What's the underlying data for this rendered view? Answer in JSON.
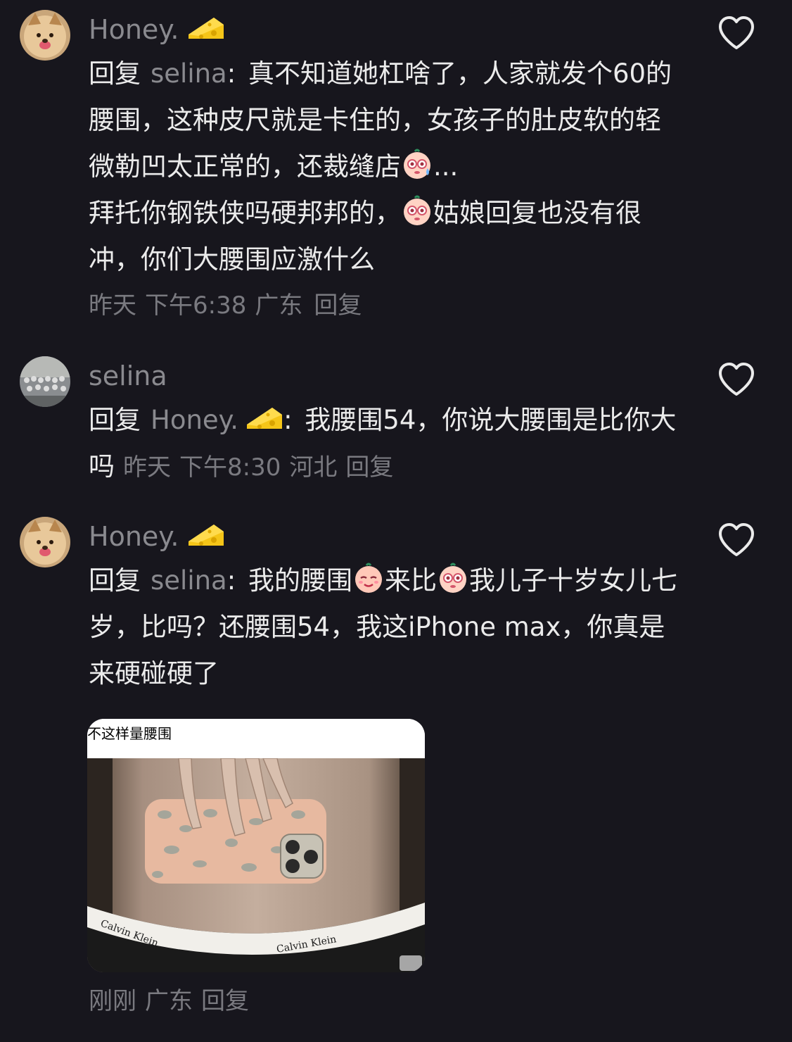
{
  "comments": [
    {
      "author": "Honey.",
      "reply_word": "回复",
      "reply_target": "selina",
      "colon": ":",
      "text": "真不知道她杠啥了，人家就发个60的腰围，这种皮尺就是卡住的，女孩子的肚皮软的轻微勒凹太正常的，还裁缝店",
      "text_tail": "...",
      "text_line2_pre": "拜托你钢铁侠吗硬邦邦的，",
      "text_line2_post": "姑娘回复也没有很冲，你们大腰围应激什么",
      "date": "昨天",
      "time": "下午6:38",
      "location": "广东",
      "reply_label": "回复"
    },
    {
      "author": "selina",
      "reply_word": "回复",
      "reply_target": "Honey.",
      "colon": ":",
      "text": "我腰围54，你说大腰围是比你大吗",
      "date": "昨天",
      "time": "下午8:30",
      "location": "河北",
      "reply_label": "回复"
    },
    {
      "author": "Honey.",
      "reply_word": "回复",
      "reply_target": "selina",
      "colon": ":",
      "text_part1": "我的腰围",
      "text_part2": "来比",
      "text_part3": "我儿子十岁女儿七岁，比吗？还腰围54，我这iPhone max，你真是来硬碰硬了",
      "image_caption": "不这样量腰围",
      "date": "刚刚",
      "location": "广东",
      "reply_label": "回复"
    }
  ],
  "icons": {
    "like": "heart-outline-icon",
    "author_badge": "cheese-icon"
  },
  "colors": {
    "background": "#17161d",
    "text": "#ebebeb",
    "secondary": "#8a8a8f"
  }
}
